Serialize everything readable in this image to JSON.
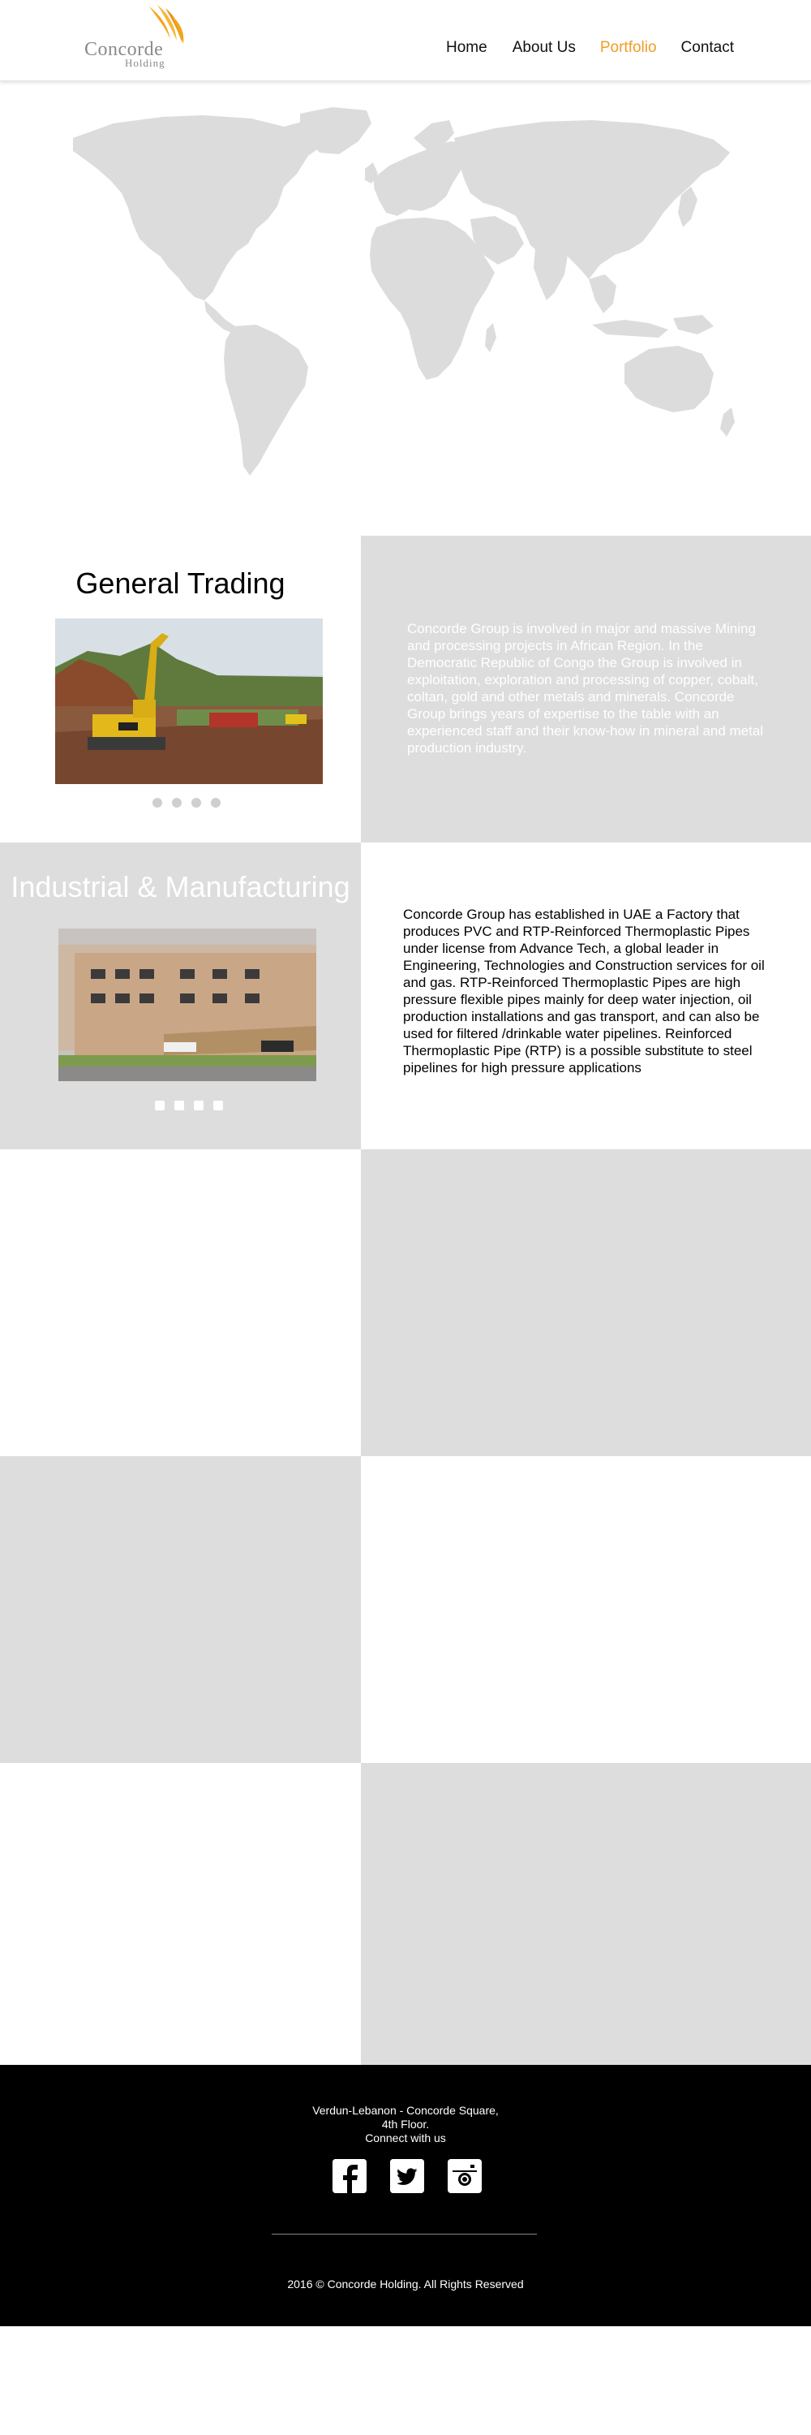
{
  "brand": {
    "name_line1": "Concorde",
    "name_line2": "Holding",
    "flame_color": "#f2a51a",
    "text_color": "#8a8a8a"
  },
  "nav": {
    "items": [
      {
        "label": "Home",
        "active": false
      },
      {
        "label": "About Us",
        "active": false
      },
      {
        "label": "Portfolio",
        "active": true
      },
      {
        "label": "Contact",
        "active": false
      }
    ],
    "active_color": "#f29b24"
  },
  "map": {
    "color": "#dcdcdc"
  },
  "sections": [
    {
      "title": "General Trading",
      "image_icon": "excavator-photo",
      "slide_count": 4,
      "text": "Concorde Group is involved in major and massive Mining and processing projects in African Region. In the Democratic Republic of Congo the Group is involved in exploitation, exploration and processing of copper, cobalt, coltan, gold and other metals and minerals. Concorde Group brings years of expertise to the table with an experienced staff and their know-how in mineral and metal production industry."
    },
    {
      "title": "Industrial & Manufacturing",
      "image_icon": "factory-building-photo",
      "slide_count": 4,
      "text": "Concorde Group has established in UAE a Factory that produces PVC and RTP-Reinforced Thermoplastic Pipes under license from Advance Tech, a global  leader in Engineering, Technologies and Construction services for oil and gas. RTP-Reinforced Thermoplastic Pipes are high pressure flexible pipes mainly for deep water injection, oil production installations and gas transport, and can also be used for filtered /drinkable water pipelines. Reinforced Thermoplastic Pipe (RTP) is a possible substitute to steel pipelines for high pressure applications"
    }
  ],
  "footer": {
    "address_line1": "Verdun-Lebanon - Concorde Square,",
    "address_line2": "4th Floor.",
    "connect_label": "Connect with us",
    "social": [
      "facebook-icon",
      "twitter-icon",
      "instagram-icon"
    ],
    "copyright": "2016 © Concorde Holding. All Rights Reserved"
  }
}
